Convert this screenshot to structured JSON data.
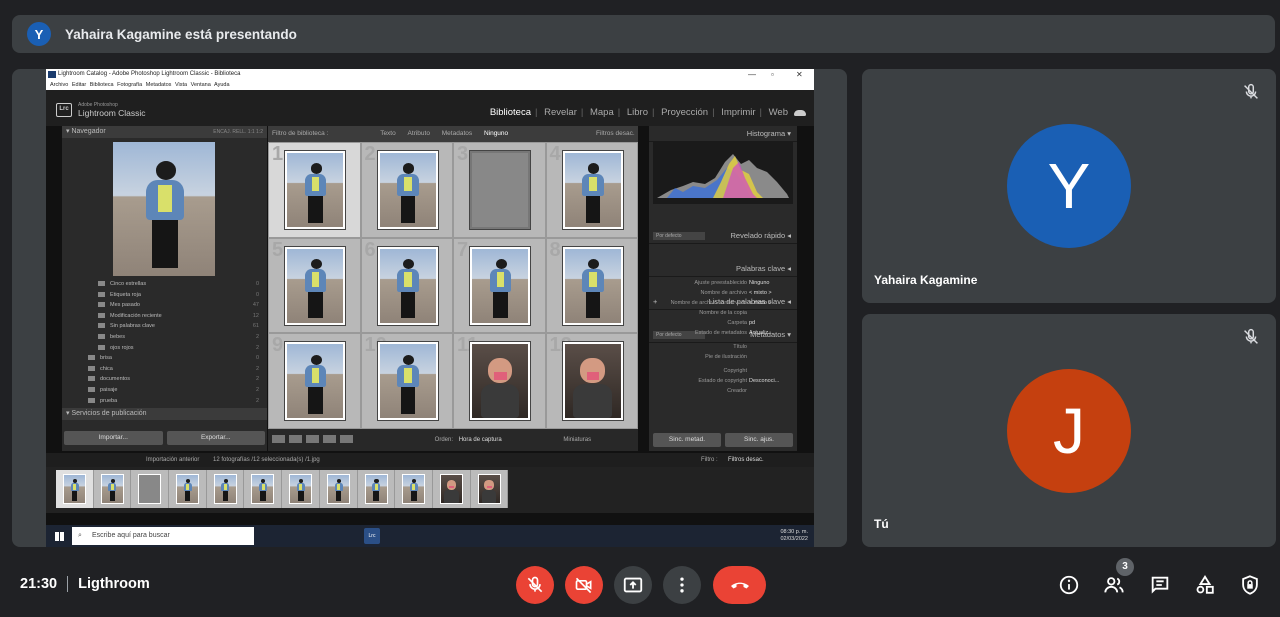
{
  "presenting": {
    "avatar_initial": "Y",
    "text": "Yahaira Kagamine está presentando"
  },
  "lightroom": {
    "window_title": "Lightroom Catalog - Adobe Photoshop Lightroom Classic - Biblioteca",
    "menu": "Archivo Editar Biblioteca Fotografía Metadatos Vista Ventana Ayuda",
    "logo": "Lrc",
    "brand_small": "Adobe Photoshop",
    "brand": "Lightroom Classic",
    "modules": [
      "Biblioteca",
      "Revelar",
      "Mapa",
      "Libro",
      "Proyección",
      "Imprimir",
      "Web"
    ],
    "navigator_label": "Navegador",
    "navigator_zoom": "ENCAJ.  RELL.  1:1  1:2",
    "collections": [
      {
        "label": "Cinco estrellas",
        "count": "0"
      },
      {
        "label": "Etiqueta roja",
        "count": "0"
      },
      {
        "label": "Mes pasado",
        "count": "47"
      },
      {
        "label": "Modificación reciente",
        "count": "12"
      },
      {
        "label": "Sin palabras clave",
        "count": "61"
      },
      {
        "label": "bebes",
        "count": "2"
      },
      {
        "label": "ojos rojos",
        "count": "2"
      },
      {
        "label": "brisa",
        "count": "0"
      },
      {
        "label": "chica",
        "count": "2"
      },
      {
        "label": "documentos",
        "count": "2"
      },
      {
        "label": "paisaje",
        "count": "2"
      },
      {
        "label": "prueba",
        "count": "2"
      }
    ],
    "services_label": "Servicios de publicación",
    "import_btn": "Importar...",
    "export_btn": "Exportar...",
    "filter_label": "Filtro de biblioteca :",
    "filter_options": [
      "Texto",
      "Atributo",
      "Metadatos",
      "Ninguno"
    ],
    "filter_off": "Filtros desac.",
    "grid_numbers": [
      "1",
      "2",
      "3",
      "4",
      "5",
      "6",
      "7",
      "8",
      "9",
      "10",
      "11",
      "12"
    ],
    "toolbar_order_label": "Orden:",
    "toolbar_order_value": "Hora de captura",
    "toolbar_thumbs": "Miniaturas",
    "right_panels": {
      "histogram": "Histograma",
      "quick_develop": "Revelado rápido",
      "keywords": "Palabras clave",
      "keyword_list": "Lista de palabras clave",
      "metadata": "Metadatos",
      "preset_default": "Por defecto"
    },
    "metadata_rows": [
      {
        "label": "Ajuste preestablecido",
        "value": "Ninguno"
      },
      {
        "label": "Nombre de archivo",
        "value": "< mixto >"
      },
      {
        "label": "Nombre de archivo conservado",
        "value": "< mixto >"
      },
      {
        "label": "Nombre de la copia",
        "value": ""
      },
      {
        "label": "Carpeta",
        "value": "pd"
      },
      {
        "label": "Estado de metadatos",
        "value": "Actualiz..."
      },
      {
        "label": "Título",
        "value": ""
      },
      {
        "label": "Pie de ilustración",
        "value": ""
      },
      {
        "label": "Copyright",
        "value": ""
      },
      {
        "label": "Estado de copyright",
        "value": "Desconoci..."
      },
      {
        "label": "Creador",
        "value": ""
      }
    ],
    "sync_meta_btn": "Sinc. metad.",
    "sync_settings_btn": "Sinc. ajus.",
    "filmstrip_source": "Importación anterior",
    "filmstrip_count": "12 fotografías /12 seleccionada(s) /1.jpg",
    "filmstrip_filter_label": "Filtro :",
    "taskbar_search": "Escribe aquí para buscar",
    "tray_time": "08:30 p. m.",
    "tray_date": "02/03/2022"
  },
  "participants": [
    {
      "name": "Yahaira Kagamine",
      "initial": "Y",
      "color": "#1a5fb4"
    },
    {
      "name": "Tú",
      "initial": "J",
      "color": "#c5400f"
    }
  ],
  "bottom": {
    "time": "21:30",
    "meeting_name": "Ligthroom",
    "participant_count": "3"
  },
  "colors": {
    "red": "#ea4335",
    "tile_bg": "#3c4043",
    "page_bg": "#202124"
  }
}
